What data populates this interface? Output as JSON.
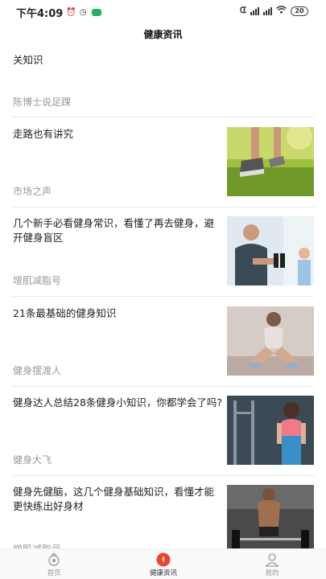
{
  "status_bar": {
    "time": "下午4:09",
    "battery": "20"
  },
  "header": {
    "title": "健康资讯"
  },
  "feed": {
    "items": [
      {
        "title": "关知识",
        "source": "陈博士说足踝"
      },
      {
        "title": "走路也有讲究",
        "source": "市场之声"
      },
      {
        "title": "几个新手必看健身常识，看懂了再去健身，避开健身盲区",
        "source": "增肌减脂号"
      },
      {
        "title": "21条最基础的健身知识",
        "source": "健身摆渡人"
      },
      {
        "title": "健身达人总结28条健身小知识，你都学会了吗?",
        "source": "健身大飞"
      },
      {
        "title": "健身先健脑，这几个健身基础知识，看懂才能更快练出好身材",
        "source": "增肌减脂号"
      }
    ]
  },
  "tabbar": {
    "tabs": [
      {
        "label": "首页",
        "icon": "home-icon"
      },
      {
        "label": "健康资讯",
        "icon": "news-icon"
      },
      {
        "label": "我的",
        "icon": "profile-icon"
      }
    ]
  },
  "colors": {
    "accent": "#e8453c",
    "divider": "#e6e6e6",
    "muted_text": "#999999"
  }
}
